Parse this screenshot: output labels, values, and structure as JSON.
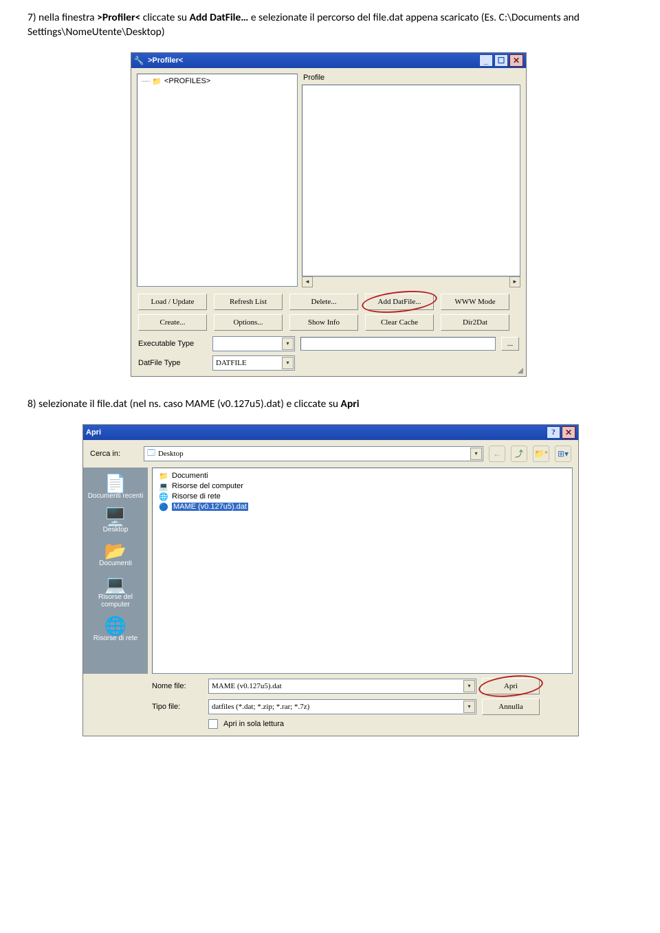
{
  "instr7_prefix": "7)  nella finestra ",
  "instr7_bold1": ">Profiler<",
  "instr7_mid": " cliccate su ",
  "instr7_bold2": "Add DatFile…",
  "instr7_suffix": " e selezionate il percorso del file.dat appena scaricato (Es. C:\\Documents and Settings\\NomeUtente\\Desktop)",
  "instr8_prefix": "8)  selezionate il file.dat (nel ns. caso MAME (v0.127u5).dat) e cliccate su ",
  "instr8_bold": "Apri",
  "profiler": {
    "title": ">Profiler<",
    "treeNode": "<PROFILES>",
    "profileLabel": "Profile",
    "buttons": {
      "load": "Load / Update",
      "refresh": "Refresh List",
      "delete": "Delete...",
      "add": "Add DatFile...",
      "www": "WWW Mode",
      "create": "Create...",
      "options": "Options...",
      "show": "Show Info",
      "clear": "Clear Cache",
      "dir2dat": "Dir2Dat"
    },
    "execLabel": "Executable Type",
    "datLabel": "DatFile Type",
    "datValue": "DATFILE",
    "browse": "..."
  },
  "open": {
    "title": "Apri",
    "lookLabel": "Cerca in:",
    "lookValue": "Desktop",
    "places": {
      "recent": "Documenti recenti",
      "desktop": "Desktop",
      "docs": "Documenti",
      "computer": "Risorse del computer",
      "network": "Risorse di rete"
    },
    "files": {
      "docs": "Documenti",
      "computer": "Risorse del computer",
      "network": "Risorse di rete",
      "mame": "MAME (v0.127u5).dat"
    },
    "fnameLabel": "Nome file:",
    "fnameValue": "MAME (v0.127u5).dat",
    "ftypeLabel": "Tipo file:",
    "ftypeValue": "datfiles (*.dat; *.zip; *.rar; *.7z)",
    "openBtn": "Apri",
    "cancelBtn": "Annulla",
    "readonly": "Apri in sola lettura"
  }
}
